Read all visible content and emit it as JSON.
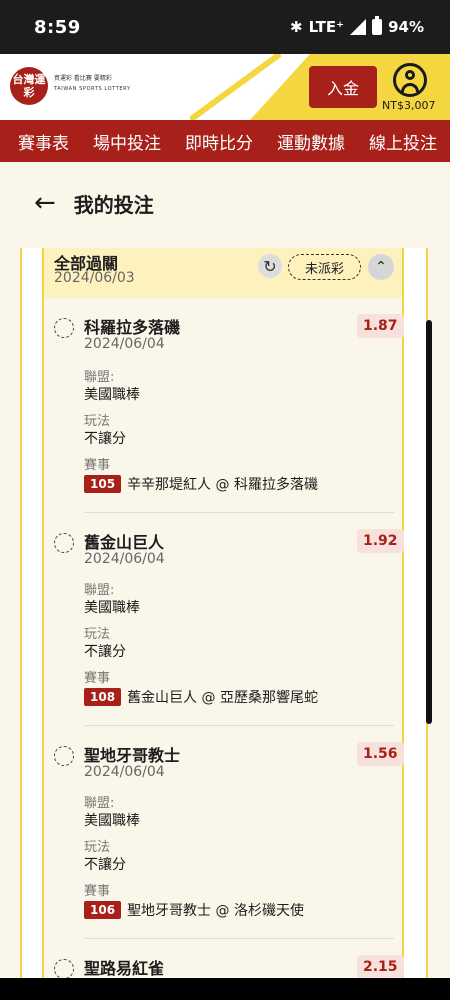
{
  "status_bar": {
    "time": "8:59",
    "network": "LTE⁺",
    "battery": "94%"
  },
  "header": {
    "logo_text": "台灣運彩",
    "logo_sub": "買運彩 看比賽 要精彩",
    "logo_en": "TAIWAN SPORTS LOTTERY",
    "deposit_label": "入金",
    "balance": "NT$3,007"
  },
  "nav": {
    "items": [
      "賽事表",
      "場中投注",
      "即時比分",
      "運動數據",
      "線上投注"
    ]
  },
  "page": {
    "title": "我的投注"
  },
  "group": {
    "title": "全部過關",
    "date": "2024/06/03",
    "status": "未派彩",
    "refresh_icon": "↻",
    "collapse_icon": "⌃"
  },
  "labels": {
    "league": "聯盟:",
    "play_type": "玩法",
    "event": "賽事"
  },
  "bets": [
    {
      "team": "科羅拉多落磯",
      "date": "2024/06/04",
      "odds": "1.87",
      "league": "美國職棒",
      "play": "不讓分",
      "game_no": "105",
      "matchup": "辛辛那堤紅人 @ 科羅拉多落磯"
    },
    {
      "team": "舊金山巨人",
      "date": "2024/06/04",
      "odds": "1.92",
      "league": "美國職棒",
      "play": "不讓分",
      "game_no": "108",
      "matchup": "舊金山巨人 @ 亞歷桑那響尾蛇"
    },
    {
      "team": "聖地牙哥教士",
      "date": "2024/06/04",
      "odds": "1.56",
      "league": "美國職棒",
      "play": "不讓分",
      "game_no": "106",
      "matchup": "聖地牙哥教士 @ 洛杉磯天使"
    },
    {
      "team": "聖路易紅雀",
      "odds": "2.15"
    }
  ],
  "colors": {
    "brand_red": "#a8201a",
    "yellow": "#f2d547"
  }
}
